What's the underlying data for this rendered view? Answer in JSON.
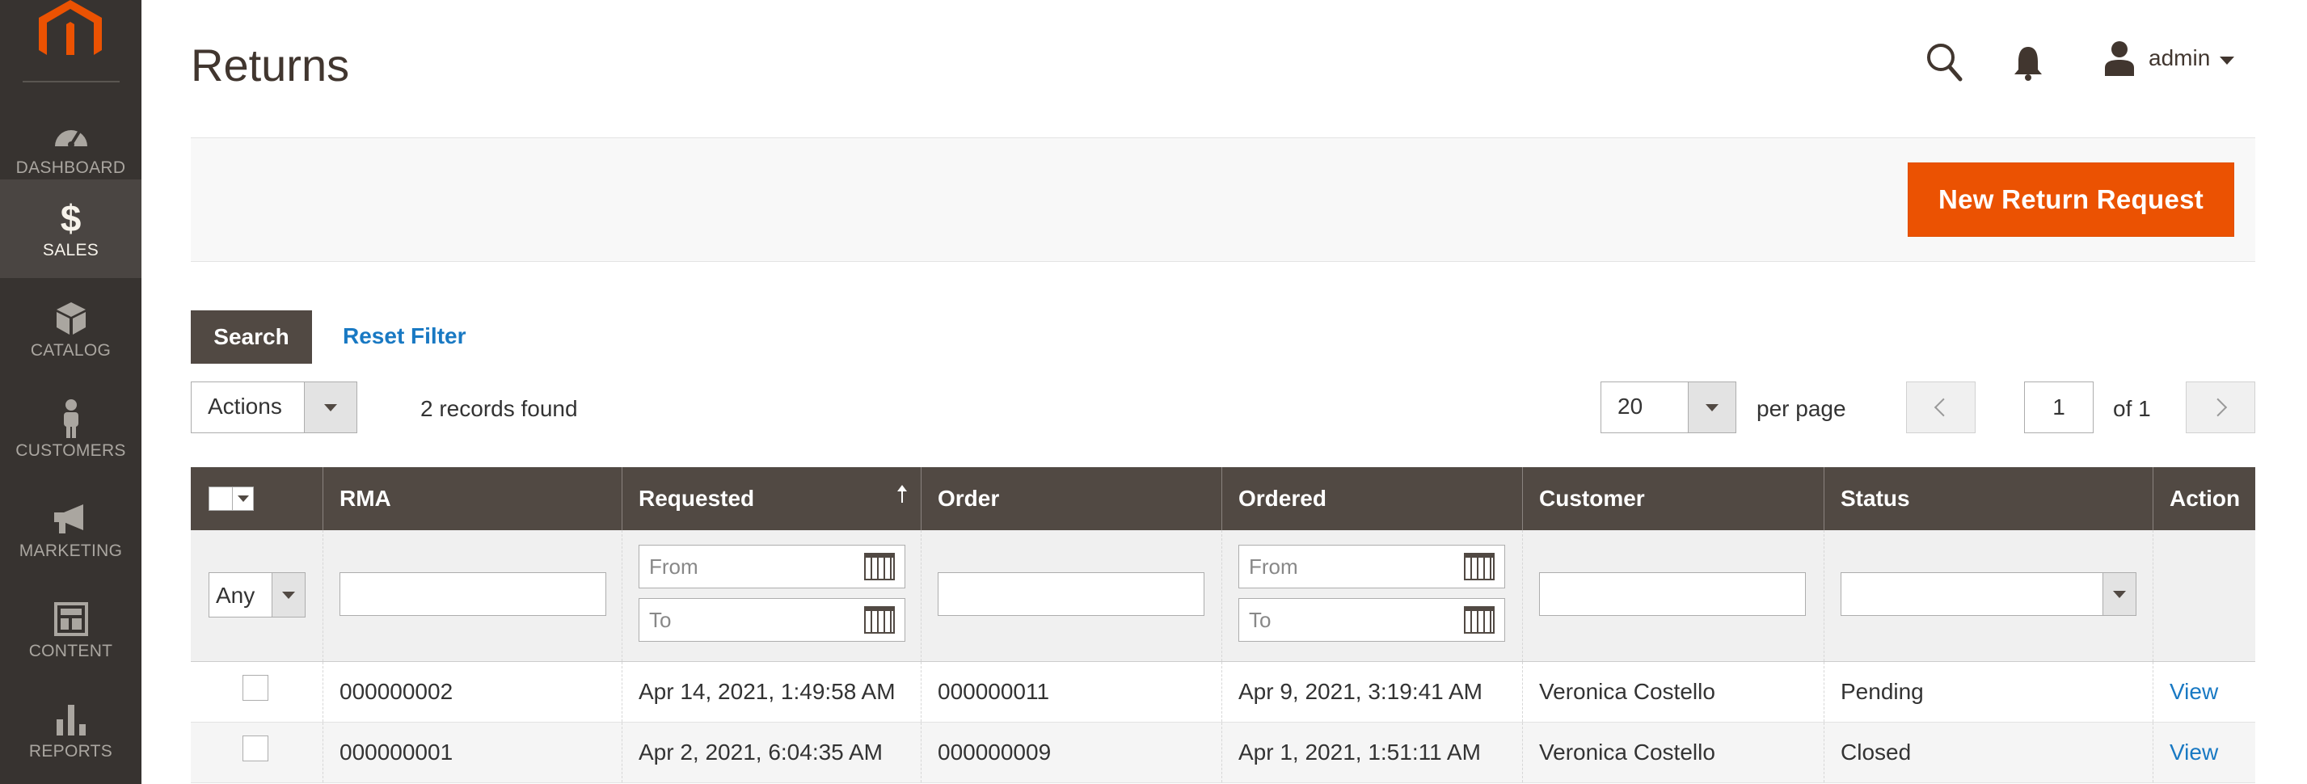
{
  "sidebar": {
    "items": [
      {
        "label": "DASHBOARD",
        "icon": "dashboard-icon"
      },
      {
        "label": "SALES",
        "icon": "dollar-icon",
        "active": true
      },
      {
        "label": "CATALOG",
        "icon": "cube-icon"
      },
      {
        "label": "CUSTOMERS",
        "icon": "person-icon"
      },
      {
        "label": "MARKETING",
        "icon": "megaphone-icon"
      },
      {
        "label": "CONTENT",
        "icon": "layout-icon"
      },
      {
        "label": "REPORTS",
        "icon": "bar-chart-icon"
      }
    ]
  },
  "header": {
    "title": "Returns",
    "username": "admin"
  },
  "toolbar": {
    "new_return_label": "New Return Request",
    "search_label": "Search",
    "reset_filter_label": "Reset Filter",
    "actions_label": "Actions",
    "records_found": "2 records found",
    "per_page_value": "20",
    "per_page_label": "per page",
    "page_value": "1",
    "page_of": "of 1"
  },
  "grid": {
    "columns": [
      "RMA",
      "Requested",
      "Order",
      "Ordered",
      "Customer",
      "Status",
      "Action"
    ],
    "filters": {
      "any_label": "Any",
      "from_placeholder": "From",
      "to_placeholder": "To"
    },
    "rows": [
      {
        "rma": "000000002",
        "requested": "Apr 14, 2021, 1:49:58 AM",
        "order": "000000011",
        "ordered": "Apr 9, 2021, 3:19:41 AM",
        "customer": "Veronica Costello",
        "status": "Pending",
        "action": "View"
      },
      {
        "rma": "000000001",
        "requested": "Apr 2, 2021, 6:04:35 AM",
        "order": "000000009",
        "ordered": "Apr 1, 2021, 1:51:11 AM",
        "customer": "Veronica Costello",
        "status": "Closed",
        "action": "View"
      }
    ]
  },
  "colors": {
    "sidebar_bg": "#373330",
    "accent": "#eb5202",
    "grid_header": "#514943",
    "link": "#1979c3"
  }
}
